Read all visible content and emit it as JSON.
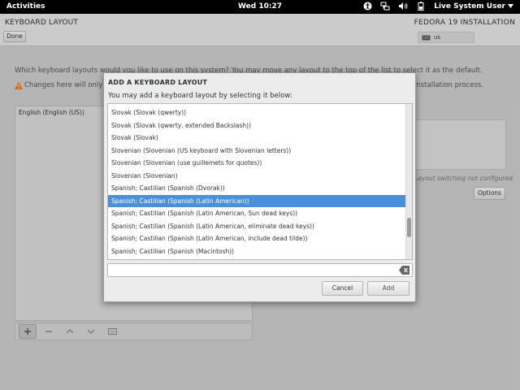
{
  "topbar": {
    "activities": "Activities",
    "clock": "Wed 10:27",
    "user": "Live System User"
  },
  "app": {
    "title": "KEYBOARD LAYOUT",
    "done_label": "Done",
    "product": "FEDORA 19 INSTALLATION",
    "keyboard_indicator": "us",
    "question": "Which keyboard layouts would you like to use on this system?  You may move any layout to the top of the list to select it as the default.",
    "warning_start": "Changes here will only",
    "warning_end": "installation process.",
    "layouts": [
      "English (English (US))"
    ],
    "switch_note": "Layout switching not configured.",
    "options_label": "Options"
  },
  "dialog": {
    "title": "ADD A KEYBOARD LAYOUT",
    "subtitle": "You may add a keyboard layout by selecting it below:",
    "items": [
      "Slovak (Slovak (qwerty))",
      "Slovak (Slovak (qwerty, extended Backslash))",
      "Slovak (Slovak)",
      "Slovenian (Slovenian (US keyboard with Slovenian letters))",
      "Slovenian (Slovenian (use guillemets for quotes))",
      "Slovenian (Slovenian)",
      "Spanish; Castilian (Spanish (Dvorak))",
      "Spanish; Castilian (Spanish (Latin American))",
      "Spanish; Castilian (Spanish (Latin American, Sun dead keys))",
      "Spanish; Castilian (Spanish (Latin American, eliminate dead keys))",
      "Spanish; Castilian (Spanish (Latin American, include dead tilde))",
      "Spanish; Castilian (Spanish (Macintosh))"
    ],
    "selected_index": 7,
    "search_value": "",
    "cancel_label": "Cancel",
    "add_label": "Add"
  },
  "colors": {
    "selection": "#4a90d9",
    "warning": "#f57900",
    "topbar": "#000000"
  }
}
